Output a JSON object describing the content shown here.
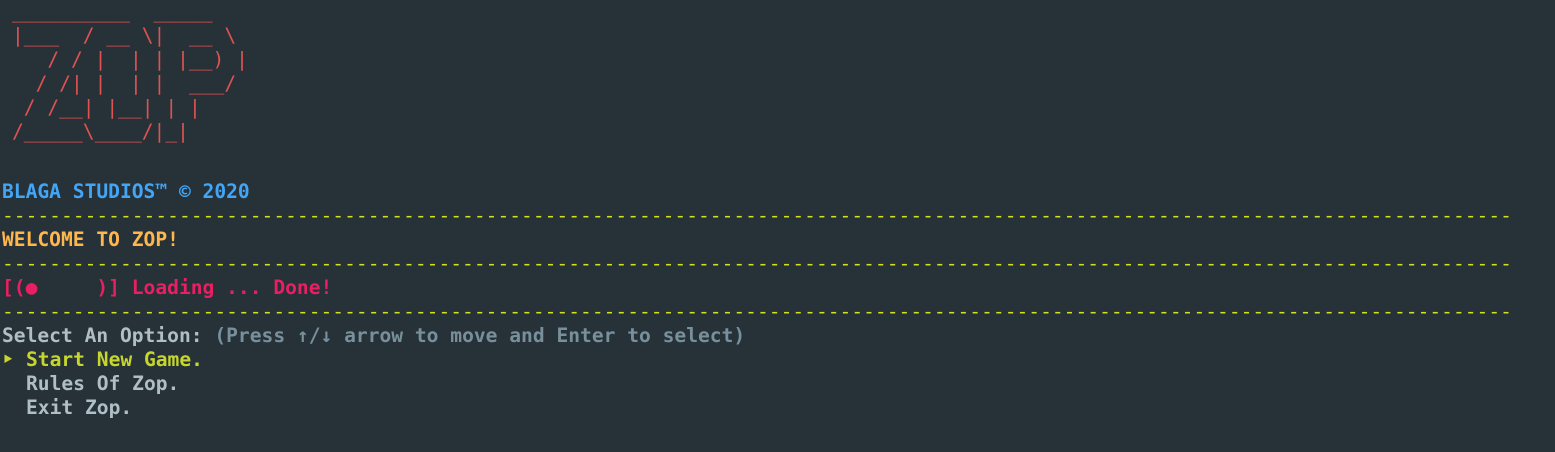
{
  "logo": {
    "ascii": "__________  _____\n|___  / __ \\|  __ \\\n   / / |  | | |__) |\n  / /| |  | |  ___/\n / /__| |__| | |\n/_____\\____/|_|",
    "color": "#e05252"
  },
  "studio": {
    "text": "BLAGA STUDIOS™ © 2020",
    "color": "#42a5f5"
  },
  "separator": {
    "text": "--------------------------------------------------------------------------------------------------------------------------------",
    "color": "#d4df1f"
  },
  "welcome": {
    "text": "WELCOME TO ZOP!",
    "color": "#ffb74d"
  },
  "loading": {
    "spinner": "[(●     )]",
    "text": "Loading ... Done!",
    "color": "#e91e63"
  },
  "prompt": {
    "label": "Select An Option:",
    "hint": "(Press ↑/↓ arrow to move and Enter to select)"
  },
  "menu": {
    "pointer": "‣",
    "items": [
      {
        "label": "Start New Game."
      },
      {
        "label": "Rules Of Zop."
      },
      {
        "label": "Exit Zop."
      }
    ],
    "selected_color": "#c6d62c"
  }
}
